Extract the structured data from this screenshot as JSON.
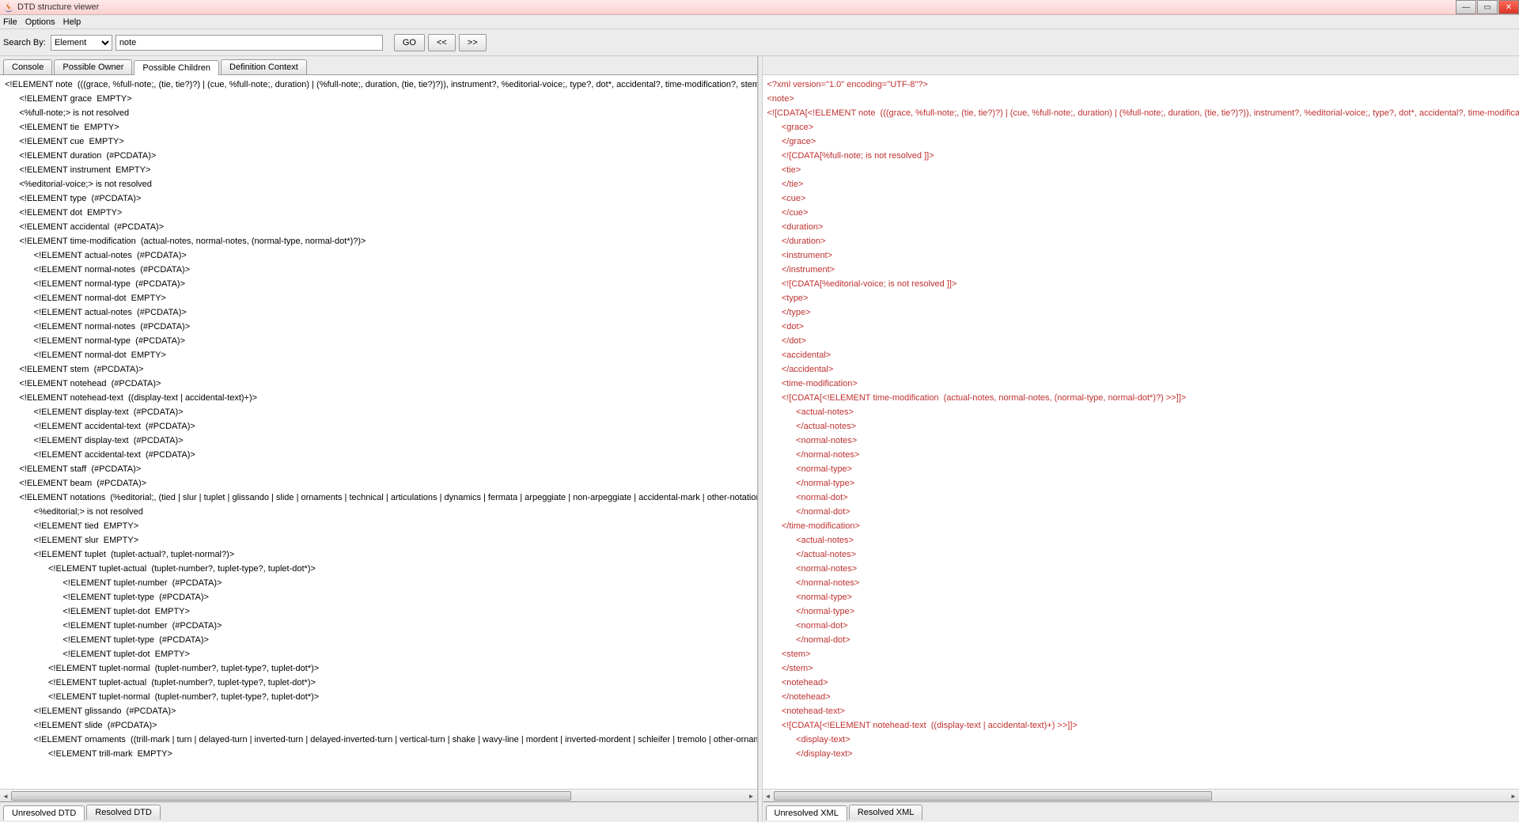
{
  "window": {
    "title": "DTD structure viewer"
  },
  "menu": {
    "items": [
      "File",
      "Options",
      "Help"
    ]
  },
  "toolbar": {
    "search_by_label": "Search By:",
    "search_type_selected": "Element",
    "search_value": "note",
    "go_label": "GO",
    "prev_label": "<<",
    "next_label": ">>"
  },
  "left_top_tabs": {
    "items": [
      "Console",
      "Possible Owner",
      "Possible Children",
      "Definition Context"
    ],
    "active": "Possible Children"
  },
  "left_bottom_tabs": {
    "items": [
      "Unresolved DTD",
      "Resolved DTD"
    ],
    "active": "Unresolved DTD"
  },
  "right_bottom_tabs": {
    "items": [
      "Unresolved XML",
      "Resolved XML"
    ],
    "active": "Unresolved XML"
  },
  "dtd_lines": [
    {
      "i": 0,
      "t": "<!ELEMENT note  (((grace, %full-note;, (tie, tie?)?) | (cue, %full-note;, duration) | (%full-note;, duration, (tie, tie?)?)), instrument?, %editorial-voice;, type?, dot*, accidental?, time-modification?, stem?, notehead?, notehead-text?, staff?, beam*, notations*)>"
    },
    {
      "i": 1,
      "t": "<!ELEMENT grace  EMPTY>"
    },
    {
      "i": 1,
      "t": "<%full-note;> is not resolved"
    },
    {
      "i": 1,
      "t": "<!ELEMENT tie  EMPTY>"
    },
    {
      "i": 1,
      "t": "<!ELEMENT cue  EMPTY>"
    },
    {
      "i": 1,
      "t": "<!ELEMENT duration  (#PCDATA)>"
    },
    {
      "i": 1,
      "t": "<!ELEMENT instrument  EMPTY>"
    },
    {
      "i": 1,
      "t": "<%editorial-voice;> is not resolved"
    },
    {
      "i": 1,
      "t": "<!ELEMENT type  (#PCDATA)>"
    },
    {
      "i": 1,
      "t": "<!ELEMENT dot  EMPTY>"
    },
    {
      "i": 1,
      "t": "<!ELEMENT accidental  (#PCDATA)>"
    },
    {
      "i": 1,
      "t": "<!ELEMENT time-modification  (actual-notes, normal-notes, (normal-type, normal-dot*)?)>"
    },
    {
      "i": 2,
      "t": "<!ELEMENT actual-notes  (#PCDATA)>"
    },
    {
      "i": 2,
      "t": "<!ELEMENT normal-notes  (#PCDATA)>"
    },
    {
      "i": 2,
      "t": "<!ELEMENT normal-type  (#PCDATA)>"
    },
    {
      "i": 2,
      "t": "<!ELEMENT normal-dot  EMPTY>"
    },
    {
      "i": 2,
      "t": "<!ELEMENT actual-notes  (#PCDATA)>"
    },
    {
      "i": 2,
      "t": "<!ELEMENT normal-notes  (#PCDATA)>"
    },
    {
      "i": 2,
      "t": "<!ELEMENT normal-type  (#PCDATA)>"
    },
    {
      "i": 2,
      "t": "<!ELEMENT normal-dot  EMPTY>"
    },
    {
      "i": 1,
      "t": "<!ELEMENT stem  (#PCDATA)>"
    },
    {
      "i": 1,
      "t": "<!ELEMENT notehead  (#PCDATA)>"
    },
    {
      "i": 1,
      "t": "<!ELEMENT notehead-text  ((display-text | accidental-text)+)>"
    },
    {
      "i": 2,
      "t": "<!ELEMENT display-text  (#PCDATA)>"
    },
    {
      "i": 2,
      "t": "<!ELEMENT accidental-text  (#PCDATA)>"
    },
    {
      "i": 2,
      "t": "<!ELEMENT display-text  (#PCDATA)>"
    },
    {
      "i": 2,
      "t": "<!ELEMENT accidental-text  (#PCDATA)>"
    },
    {
      "i": 1,
      "t": "<!ELEMENT staff  (#PCDATA)>"
    },
    {
      "i": 1,
      "t": "<!ELEMENT beam  (#PCDATA)>"
    },
    {
      "i": 1,
      "t": "<!ELEMENT notations  (%editorial;, (tied | slur | tuplet | glissando | slide | ornaments | technical | articulations | dynamics | fermata | arpeggiate | non-arpeggiate | accidental-mark | other-notation)*)>"
    },
    {
      "i": 2,
      "t": "<%editorial;> is not resolved"
    },
    {
      "i": 2,
      "t": "<!ELEMENT tied  EMPTY>"
    },
    {
      "i": 2,
      "t": "<!ELEMENT slur  EMPTY>"
    },
    {
      "i": 2,
      "t": "<!ELEMENT tuplet  (tuplet-actual?, tuplet-normal?)>"
    },
    {
      "i": 3,
      "t": "<!ELEMENT tuplet-actual  (tuplet-number?, tuplet-type?, tuplet-dot*)>"
    },
    {
      "i": 4,
      "t": "<!ELEMENT tuplet-number  (#PCDATA)>"
    },
    {
      "i": 4,
      "t": "<!ELEMENT tuplet-type  (#PCDATA)>"
    },
    {
      "i": 4,
      "t": "<!ELEMENT tuplet-dot  EMPTY>"
    },
    {
      "i": 4,
      "t": "<!ELEMENT tuplet-number  (#PCDATA)>"
    },
    {
      "i": 4,
      "t": "<!ELEMENT tuplet-type  (#PCDATA)>"
    },
    {
      "i": 4,
      "t": "<!ELEMENT tuplet-dot  EMPTY>"
    },
    {
      "i": 3,
      "t": "<!ELEMENT tuplet-normal  (tuplet-number?, tuplet-type?, tuplet-dot*)>"
    },
    {
      "i": 3,
      "t": "<!ELEMENT tuplet-actual  (tuplet-number?, tuplet-type?, tuplet-dot*)>"
    },
    {
      "i": 3,
      "t": "<!ELEMENT tuplet-normal  (tuplet-number?, tuplet-type?, tuplet-dot*)>"
    },
    {
      "i": 2,
      "t": "<!ELEMENT glissando  (#PCDATA)>"
    },
    {
      "i": 2,
      "t": "<!ELEMENT slide  (#PCDATA)>"
    },
    {
      "i": 2,
      "t": "<!ELEMENT ornaments  ((trill-mark | turn | delayed-turn | inverted-turn | delayed-inverted-turn | vertical-turn | shake | wavy-line | mordent | inverted-mordent | schleifer | tremolo | other-ornament | accidental-mark)*)>"
    },
    {
      "i": 3,
      "t": "<!ELEMENT trill-mark  EMPTY>"
    }
  ],
  "xml_lines": [
    {
      "i": 0,
      "t": "<?xml version=\"1.0\" encoding=\"UTF-8\"?>"
    },
    {
      "i": 0,
      "t": "<note>"
    },
    {
      "i": 0,
      "t": "<![CDATA[<!ELEMENT note  (((grace, %full-note;, (tie, tie?)?) | (cue, %full-note;, duration) | (%full-note;, duration, (tie, tie?)?)), instrument?, %editorial-voice;, type?, dot*, accidental?, time-modification?, stem?, notehead?, notehead-text?, staff?, beam*, notations*)>]]>"
    },
    {
      "i": 1,
      "t": "<grace>"
    },
    {
      "i": 1,
      "t": "</grace>"
    },
    {
      "i": 1,
      "t": "<![CDATA[%full-note; is not resolved ]]>"
    },
    {
      "i": 1,
      "t": "<tie>"
    },
    {
      "i": 1,
      "t": "</tie>"
    },
    {
      "i": 1,
      "t": "<cue>"
    },
    {
      "i": 1,
      "t": "</cue>"
    },
    {
      "i": 1,
      "t": "<duration>"
    },
    {
      "i": 1,
      "t": "</duration>"
    },
    {
      "i": 1,
      "t": "<instrument>"
    },
    {
      "i": 1,
      "t": "</instrument>"
    },
    {
      "i": 1,
      "t": "<![CDATA[%editorial-voice; is not resolved ]]>"
    },
    {
      "i": 1,
      "t": "<type>"
    },
    {
      "i": 1,
      "t": "</type>"
    },
    {
      "i": 1,
      "t": "<dot>"
    },
    {
      "i": 1,
      "t": "</dot>"
    },
    {
      "i": 1,
      "t": "<accidental>"
    },
    {
      "i": 1,
      "t": "</accidental>"
    },
    {
      "i": 1,
      "t": "<time-modification>"
    },
    {
      "i": 1,
      "t": "<![CDATA[<!ELEMENT time-modification  (actual-notes, normal-notes, (normal-type, normal-dot*)?) >>]]>"
    },
    {
      "i": 2,
      "t": "<actual-notes>"
    },
    {
      "i": 2,
      "t": "</actual-notes>"
    },
    {
      "i": 2,
      "t": "<normal-notes>"
    },
    {
      "i": 2,
      "t": "</normal-notes>"
    },
    {
      "i": 2,
      "t": "<normal-type>"
    },
    {
      "i": 2,
      "t": "</normal-type>"
    },
    {
      "i": 2,
      "t": "<normal-dot>"
    },
    {
      "i": 2,
      "t": "</normal-dot>"
    },
    {
      "i": 1,
      "t": "</time-modification>"
    },
    {
      "i": 2,
      "t": "<actual-notes>"
    },
    {
      "i": 2,
      "t": "</actual-notes>"
    },
    {
      "i": 2,
      "t": "<normal-notes>"
    },
    {
      "i": 2,
      "t": "</normal-notes>"
    },
    {
      "i": 2,
      "t": "<normal-type>"
    },
    {
      "i": 2,
      "t": "</normal-type>"
    },
    {
      "i": 2,
      "t": "<normal-dot>"
    },
    {
      "i": 2,
      "t": "</normal-dot>"
    },
    {
      "i": 1,
      "t": "<stem>"
    },
    {
      "i": 1,
      "t": "</stem>"
    },
    {
      "i": 1,
      "t": "<notehead>"
    },
    {
      "i": 1,
      "t": "</notehead>"
    },
    {
      "i": 1,
      "t": "<notehead-text>"
    },
    {
      "i": 1,
      "t": "<![CDATA[<!ELEMENT notehead-text  ((display-text | accidental-text)+) >>]]>"
    },
    {
      "i": 2,
      "t": "<display-text>"
    },
    {
      "i": 2,
      "t": "</display-text>"
    }
  ]
}
